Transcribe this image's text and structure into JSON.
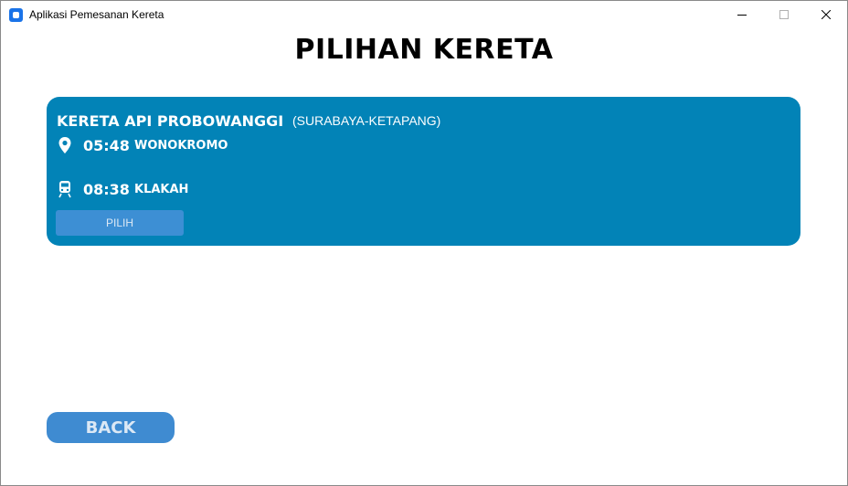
{
  "window": {
    "title": "Aplikasi Pemesanan Kereta",
    "icon": "app-icon",
    "controls": [
      "minimize-icon",
      "maximize-icon",
      "close-icon"
    ]
  },
  "page": {
    "title": "PILIHAN KERETA"
  },
  "trains": [
    {
      "name": "KERETA API PROBOWANGGI",
      "route": "(SURABAYA-KETAPANG)",
      "departure": {
        "icon": "location-pin-icon",
        "time": "05:48",
        "station": "WONOKROMO"
      },
      "arrival": {
        "icon": "train-icon",
        "time": "08:38",
        "station": "KLAKAH"
      },
      "select_label": "PILIH"
    }
  ],
  "footer": {
    "back_label": "BACK"
  },
  "colors": {
    "card": "#0283b7",
    "button": "#3f8bd1",
    "select_button": "#3d8fd4",
    "text_on_card": "#ffffff"
  }
}
